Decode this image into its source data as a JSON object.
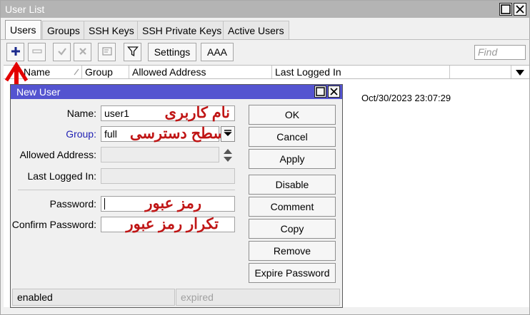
{
  "window": {
    "title": "User List"
  },
  "tabs": [
    {
      "label": "Users",
      "active": true
    },
    {
      "label": "Groups",
      "active": false
    },
    {
      "label": "SSH Keys",
      "active": false
    },
    {
      "label": "SSH Private Keys",
      "active": false
    },
    {
      "label": "Active Users",
      "active": false
    }
  ],
  "toolbar": {
    "add_icon": "plus-icon",
    "remove_icon": "minus-icon",
    "enable_icon": "check-icon",
    "disable_icon": "x-icon",
    "comment_icon": "comment-icon",
    "filter_icon": "filter-icon",
    "settings_label": "Settings",
    "aaa_label": "AAA",
    "find_placeholder": "Find"
  },
  "columns": [
    {
      "label": "Name"
    },
    {
      "label": "Group"
    },
    {
      "label": "Allowed Address"
    },
    {
      "label": "Last Logged In"
    }
  ],
  "rows": [
    {
      "last_logged_in": "Oct/30/2023 23:07:29"
    }
  ],
  "dialog": {
    "title": "New User",
    "fields": {
      "name": {
        "label": "Name:",
        "value": "user1",
        "annotation": "نام کاربری"
      },
      "group": {
        "label": "Group:",
        "value": "full",
        "annotation": "سطح دسترسی"
      },
      "allowed_address": {
        "label": "Allowed Address:",
        "value": ""
      },
      "last_logged_in": {
        "label": "Last Logged In:",
        "value": ""
      },
      "password": {
        "label": "Password:",
        "value": "",
        "annotation": "رمز عبور"
      },
      "confirm_password": {
        "label": "Confirm Password:",
        "value": "",
        "annotation": "تکرار رمز عبور"
      }
    },
    "buttons": {
      "ok": "OK",
      "cancel": "Cancel",
      "apply": "Apply",
      "disable": "Disable",
      "comment": "Comment",
      "copy": "Copy",
      "remove": "Remove",
      "expire_password": "Expire Password"
    },
    "status": {
      "left": "enabled",
      "right": "expired"
    }
  },
  "colors": {
    "dialog_title": "#5454d0",
    "annotation": "#c01616",
    "arrow": "#e30000",
    "add_icon": "#1b2a8c"
  }
}
